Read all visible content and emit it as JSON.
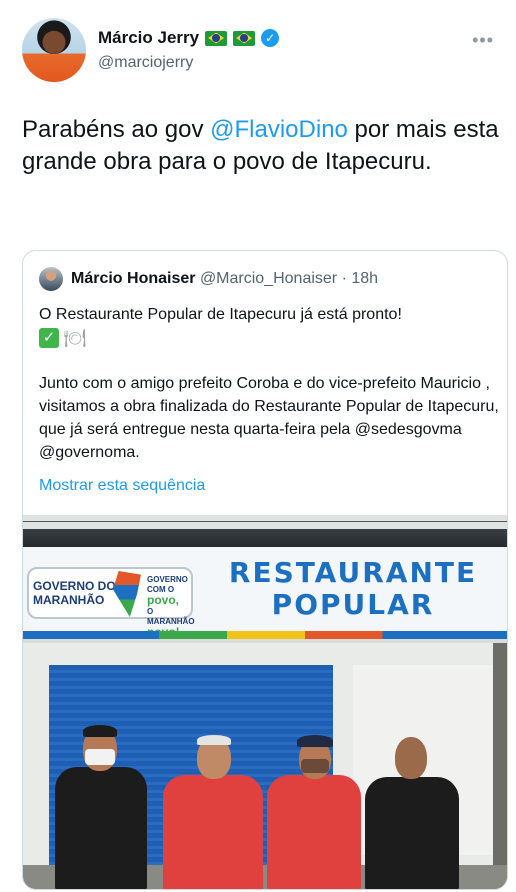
{
  "author": {
    "display_name": "Márcio Jerry",
    "handle": "@marciojerry",
    "flags": [
      "brazil-flag",
      "brazil-flag"
    ],
    "verified": true
  },
  "menu": {
    "more_label": "•••"
  },
  "tweet": {
    "text_before": "Parabéns ao gov ",
    "mention": "@FlavioDino",
    "text_after": " por mais esta grande obra para o povo de Itapecuru."
  },
  "quote": {
    "author_name": "Márcio Honaiser",
    "author_handle": "@Marcio_Honaiser",
    "time_sep": " · ",
    "time": "18h",
    "paragraph1": "O Restaurante Popular de Itapecuru já está pronto!",
    "emoji1": "✓",
    "emoji2": "🍽",
    "paragraph2": "Junto com o amigo prefeito Coroba e do vice-prefeito Mauricio , visitamos a obra finalizada do Restaurante Popular de Itapecuru, que já será entregue nesta quarta-feira pela @sedesgovma @governoma.",
    "show_thread": "Mostrar esta sequência"
  },
  "photo": {
    "sign_title_line1": "RESTAURANTE",
    "sign_title_line2": "POPULAR",
    "gov_line1": "GOVERNO DO",
    "gov_line2": "MARANHÃO",
    "gov_slogan1": "GOVERNO COM O",
    "gov_slogan2": "povo,",
    "gov_slogan3": "O MARANHÃO",
    "gov_slogan4": "novo!",
    "colors": {
      "sign_blue": "#1d6fc2",
      "shutter_blue": "#1f5fb3",
      "shirt_red": "#e0413f",
      "shirt_black": "#1c1c1c"
    }
  }
}
